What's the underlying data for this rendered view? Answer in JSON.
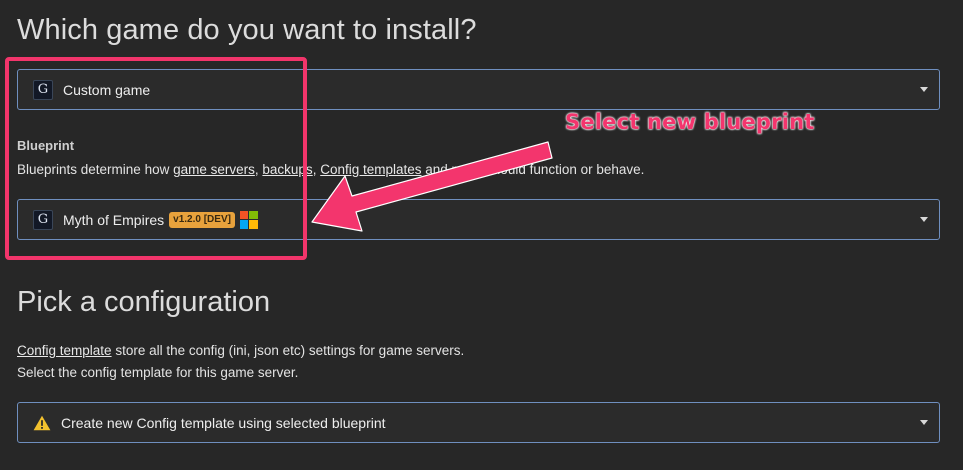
{
  "install_section": {
    "title": "Which game do you want to install?",
    "game_select": {
      "icon": "G",
      "value": "Custom game"
    }
  },
  "blueprint": {
    "label": "Blueprint",
    "description_prefix": "Blueprints determine how ",
    "link_game_servers": "game servers",
    "sep1": ", ",
    "link_backups": "backups",
    "sep2": ", ",
    "link_config_templates": "Config templates",
    "description_suffix": " and more should function or behave.",
    "select": {
      "icon": "G",
      "value": "Myth of Empires",
      "version_badge": "v1.2.0 [DEV]",
      "platform_icon": "windows-icon"
    }
  },
  "config_section": {
    "title": "Pick a configuration",
    "line1_link": "Config template",
    "line1_suffix": " store all the config (ini, json etc) settings for game servers.",
    "line2": "Select the config template for this game server.",
    "select": {
      "icon": "warning-icon",
      "value": "Create new Config template using selected blueprint"
    }
  },
  "annotation": {
    "text": "Select new blueprint",
    "color": "#f3356d"
  },
  "colors": {
    "background": "#272727",
    "select_border": "#6f8fbf",
    "badge": "#e8a23c",
    "highlight": "#f2356b"
  }
}
